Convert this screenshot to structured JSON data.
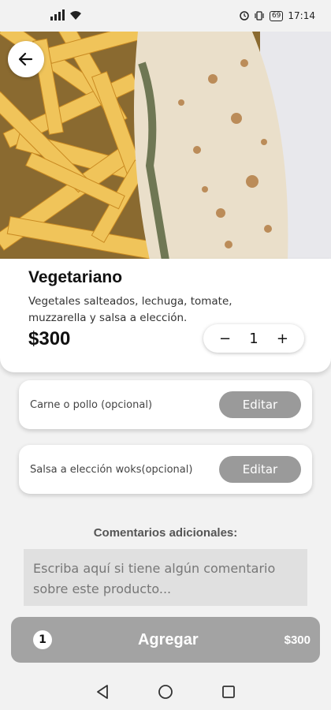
{
  "status_bar": {
    "time": "17:14",
    "battery": "69",
    "icons": [
      "signal-icon",
      "wifi-icon",
      "alarm-icon",
      "vibrate-icon",
      "battery-icon"
    ]
  },
  "hero": {
    "icon": "arrow-left-icon"
  },
  "product": {
    "name": "Vegetariano",
    "description": "Vegetales salteados, lechuga, tomate, muzzarella y salsa a elección.",
    "price": "$300",
    "quantity": "1",
    "minus": "−",
    "plus": "+"
  },
  "options": [
    {
      "label": "Carne o pollo  (opcional)",
      "button": "Editar"
    },
    {
      "label": "Salsa a elección woks(opcional)",
      "button": "Editar"
    }
  ],
  "comments": {
    "title": "Comentarios adicionales:",
    "placeholder": "Escriba aquí si tiene algún comentario sobre este producto..."
  },
  "add_bar": {
    "count": "1",
    "label": "Agregar",
    "total": "$300"
  },
  "colors": {
    "button_gray": "#9a9a9a",
    "add_bar": "#a3a3a3",
    "background": "#f2f2f2"
  }
}
